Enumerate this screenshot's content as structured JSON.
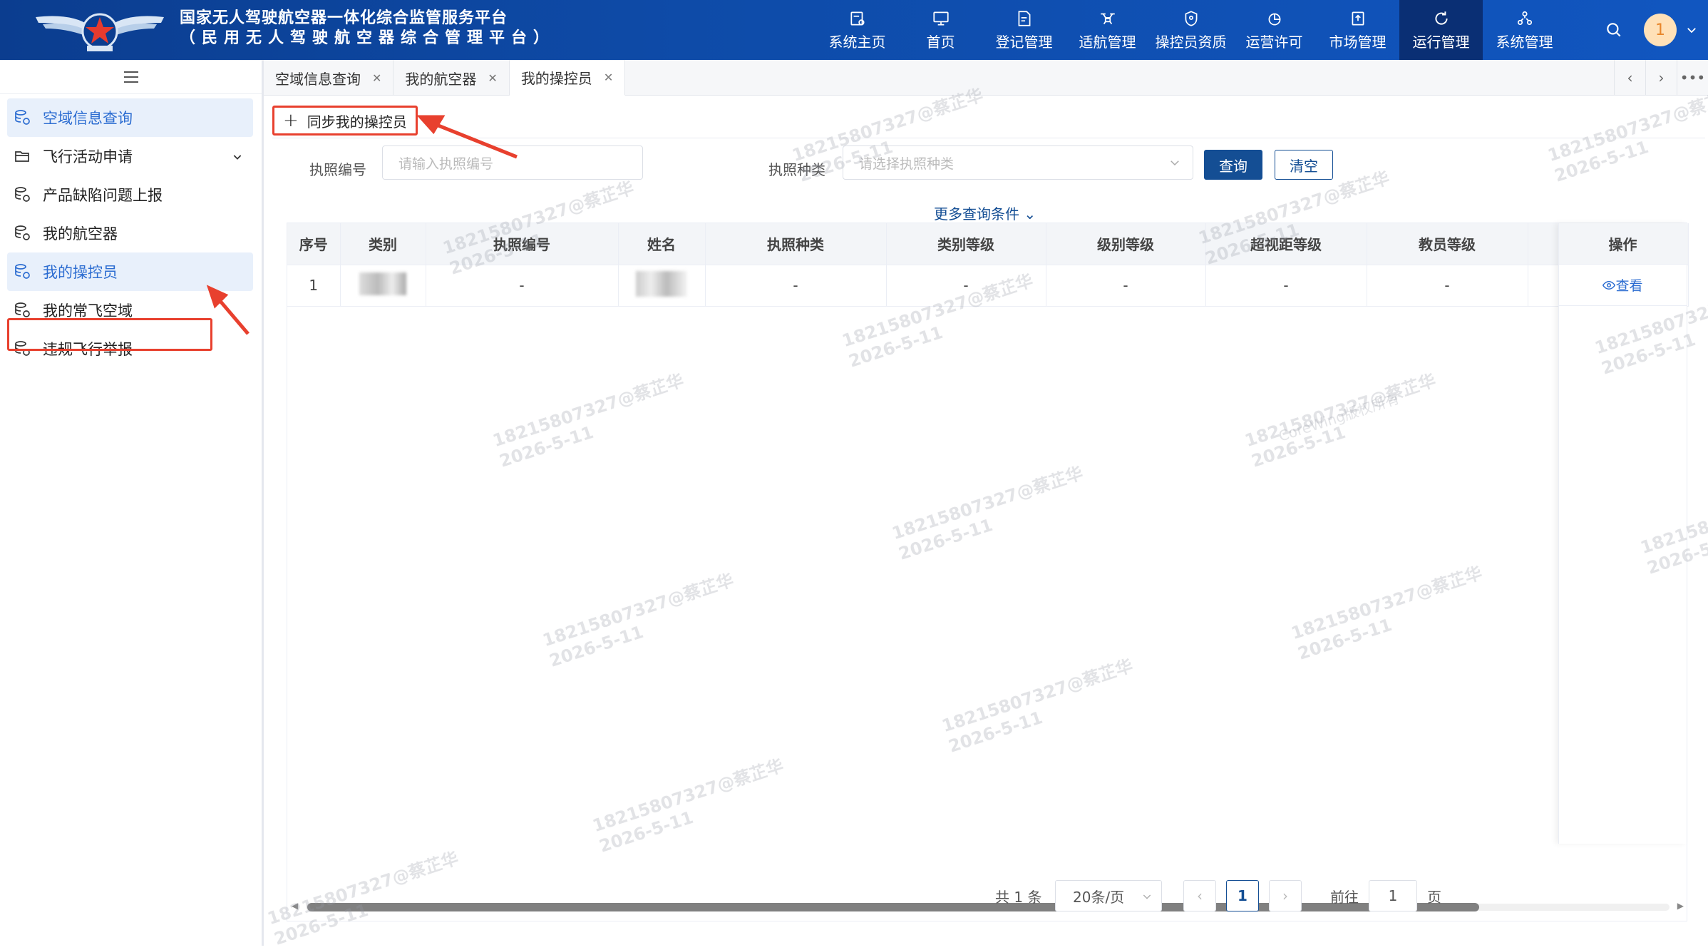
{
  "header": {
    "title_line1": "国家无人驾驶航空器一体化综合监管服务平台",
    "title_line2": "（民用无人驾驶航空器综合管理平台）",
    "nav": [
      {
        "label": "系统主页",
        "icon": "doc-gear-icon"
      },
      {
        "label": "首页",
        "icon": "monitor-icon"
      },
      {
        "label": "登记管理",
        "icon": "doc-edit-icon"
      },
      {
        "label": "适航管理",
        "icon": "drone-icon"
      },
      {
        "label": "操控员资质",
        "icon": "shield-icon"
      },
      {
        "label": "运营许可",
        "icon": "pie-icon"
      },
      {
        "label": "市场管理",
        "icon": "upload-doc-icon"
      },
      {
        "label": "运行管理",
        "icon": "refresh-icon",
        "active": true
      },
      {
        "label": "系统管理",
        "icon": "network-icon"
      }
    ],
    "avatar_text": "1"
  },
  "sidebar": {
    "items": [
      {
        "label": "空域信息查询",
        "active": true
      },
      {
        "label": "飞行活动申请",
        "expandable": true
      },
      {
        "label": "产品缺陷问题上报"
      },
      {
        "label": "我的航空器"
      },
      {
        "label": "我的操控员",
        "active": true
      },
      {
        "label": "我的常飞空域"
      },
      {
        "label": "违规飞行举报"
      }
    ]
  },
  "tabs": [
    {
      "label": "空域信息查询"
    },
    {
      "label": "我的航空器"
    },
    {
      "label": "我的操控员",
      "active": true
    }
  ],
  "toolbar": {
    "sync_label": "同步我的操控员"
  },
  "filters": {
    "license_no_label": "执照编号",
    "license_no_placeholder": "请输入执照编号",
    "license_type_label": "执照种类",
    "license_type_placeholder": "请选择执照种类",
    "query_label": "查询",
    "clear_label": "清空",
    "more_label": "更多查询条件"
  },
  "table": {
    "columns": [
      "序号",
      "类别",
      "执照编号",
      "姓名",
      "执照种类",
      "类别等级",
      "级别等级",
      "超视距等级",
      "教员等级",
      "操作"
    ],
    "rows": [
      {
        "index": "1",
        "category": "[blurred]",
        "license_no": "-",
        "name": "[blurred]",
        "license_type": "-",
        "category_level": "-",
        "class_level": "-",
        "bvlos_level": "-",
        "instructor_level": "-",
        "action": "查看"
      }
    ]
  },
  "pagination": {
    "total": "共 1 条",
    "page_size": "20条/页",
    "current_page": "1",
    "goto_label": "前往",
    "goto_value": "1",
    "page_suffix": "页"
  },
  "watermark": {
    "text1": "18215807327@蔡芷华",
    "text2": "2026-5-11",
    "copyright": "CoreWing版权所有"
  },
  "colors": {
    "header_bg": "#0e4ba8",
    "active_nav": "#0a2f74",
    "primary": "#144e94",
    "link": "#2b6cd1",
    "annotation_red": "#e8402e"
  }
}
